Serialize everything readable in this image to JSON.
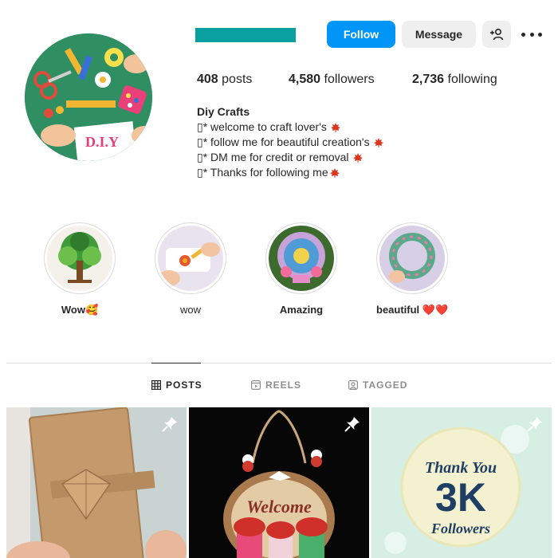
{
  "header": {
    "follow_label": "Follow",
    "message_label": "Message",
    "adduser_icon": "add-user-icon",
    "more_icon": "more-options-icon",
    "username_bar_color": "#0aa0a0"
  },
  "stats": {
    "posts_count": "408",
    "posts_label": " posts",
    "followers_count": "4,580",
    "followers_label": " followers",
    "following_count": "2,736",
    "following_label": " following"
  },
  "bio": {
    "name": "Diy Crafts",
    "lines": [
      "▯* welcome to craft lover's",
      "▯* follow me for beautiful creation's",
      "▯* DM me for credit or removal",
      "▯* Thanks for following me"
    ]
  },
  "avatar": {
    "label": "D.I.Y"
  },
  "highlights": [
    {
      "label": "Wow🥰"
    },
    {
      "label": "wow"
    },
    {
      "label": "Amazing"
    },
    {
      "label": "beautiful ❤️❤️"
    }
  ],
  "tabs": {
    "posts": "POSTS",
    "reels": "REELS",
    "tagged": "TAGGED"
  },
  "posts": [
    {
      "pinned": true,
      "icon": "pin-icon"
    },
    {
      "pinned": true,
      "icon": "pin-icon",
      "sign_text": "Welcome"
    },
    {
      "pinned": true,
      "icon": "pin-icon",
      "line1": "Thank You",
      "line2": "3K",
      "line3": "Followers"
    }
  ],
  "colors": {
    "accent": "#0095f6",
    "leaf": "#d9381e"
  }
}
